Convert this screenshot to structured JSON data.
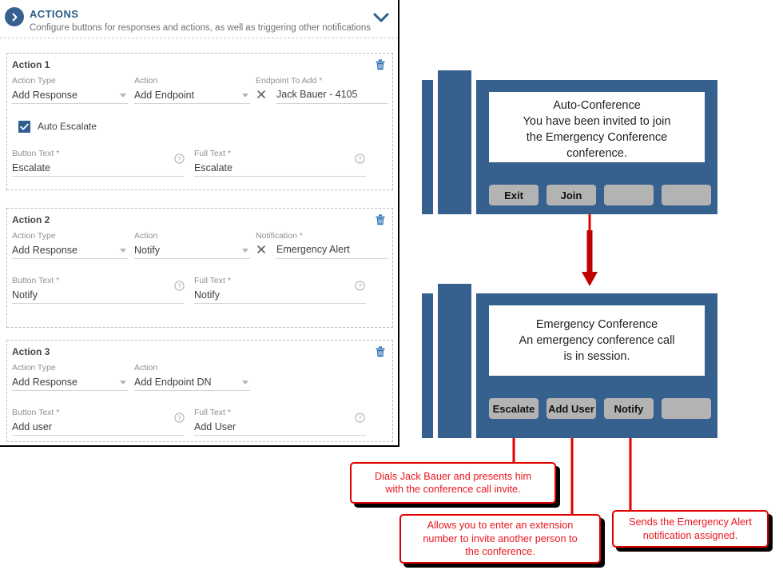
{
  "panel": {
    "header": {
      "title": "ACTIONS",
      "subtitle": "Configure buttons for responses and actions, as well as triggering other notifications",
      "expand_icon": "chevron-down-icon",
      "badge_icon": "chevron-right-circle-icon"
    },
    "labels": {
      "action_type": "Action Type",
      "action": "Action",
      "button_text": "Button Text *",
      "full_text": "Full Text *",
      "endpoint_to_add": "Endpoint To Add *",
      "notification": "Notification *",
      "auto_escalate": "Auto Escalate"
    },
    "actions": [
      {
        "title": "Action 1",
        "action_type": "Add Response",
        "action": "Add Endpoint",
        "target_label": "Endpoint To Add *",
        "target_value": "Jack Bauer - 4105",
        "has_checkbox": true,
        "checkbox_label": "Auto Escalate",
        "checkbox_checked": true,
        "button_text": "Escalate",
        "full_text": "Escalate"
      },
      {
        "title": "Action 2",
        "action_type": "Add Response",
        "action": "Notify",
        "target_label": "Notification *",
        "target_value": "Emergency Alert",
        "has_checkbox": false,
        "button_text": "Notify",
        "full_text": "Notify"
      },
      {
        "title": "Action 3",
        "action_type": "Add Response",
        "action": "Add Endpoint DN",
        "target_label": "",
        "target_value": "",
        "has_checkbox": false,
        "button_text": "Add user",
        "full_text": "Add User"
      }
    ]
  },
  "diagram": {
    "phones": [
      {
        "id": "phone-top",
        "screen_title": "Auto-Conference",
        "screen_lines": [
          "You have been invited to join",
          "the Emergency Conference",
          "conference."
        ],
        "softkeys": [
          "Exit",
          "Join",
          "",
          ""
        ]
      },
      {
        "id": "phone-bottom",
        "screen_title": "Emergency Conference",
        "screen_lines": [
          "An emergency conference call",
          "is in session."
        ],
        "softkeys": [
          "Escalate",
          "Add User",
          "Notify",
          ""
        ]
      }
    ],
    "flow_arrow": "down-arrow-icon",
    "callouts": [
      {
        "id": "callout-escalate",
        "lines": [
          "Dials Jack Bauer and presents him",
          "with the conference call invite."
        ]
      },
      {
        "id": "callout-add-user",
        "lines": [
          "Allows you to enter an extension",
          "number to invite another person to",
          "the conference."
        ]
      },
      {
        "id": "callout-notify",
        "lines": [
          "Sends the Emergency Alert",
          "notification assigned."
        ]
      }
    ]
  },
  "colors": {
    "brand_blue": "#36618f",
    "header_blue": "#2b5c8a",
    "checkbox_blue": "#2e5f93",
    "callout_red": "#e8171f",
    "arrow_red": "#c00000",
    "softkey_grey": "#b3b3b3"
  }
}
